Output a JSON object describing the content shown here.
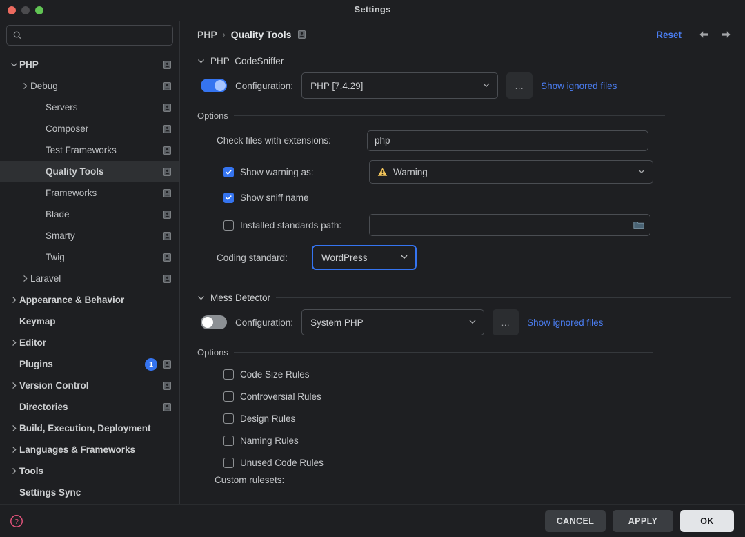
{
  "window": {
    "title": "Settings",
    "traffic_lights": [
      "close",
      "minimize",
      "zoom"
    ]
  },
  "sidebar": {
    "search": {
      "value": "",
      "placeholder": ""
    },
    "items": [
      {
        "label": "PHP",
        "indent": 0,
        "arrow": "down",
        "bold": true,
        "selected": false,
        "project_icon": true,
        "badge": null
      },
      {
        "label": "Debug",
        "indent": 1,
        "arrow": "right",
        "bold": false,
        "selected": false,
        "project_icon": true,
        "badge": null
      },
      {
        "label": "Servers",
        "indent": 2,
        "arrow": "none",
        "bold": false,
        "selected": false,
        "project_icon": true,
        "badge": null
      },
      {
        "label": "Composer",
        "indent": 2,
        "arrow": "none",
        "bold": false,
        "selected": false,
        "project_icon": true,
        "badge": null
      },
      {
        "label": "Test Frameworks",
        "indent": 2,
        "arrow": "none",
        "bold": false,
        "selected": false,
        "project_icon": true,
        "badge": null
      },
      {
        "label": "Quality Tools",
        "indent": 2,
        "arrow": "none",
        "bold": true,
        "selected": true,
        "project_icon": true,
        "badge": null
      },
      {
        "label": "Frameworks",
        "indent": 2,
        "arrow": "none",
        "bold": false,
        "selected": false,
        "project_icon": true,
        "badge": null
      },
      {
        "label": "Blade",
        "indent": 2,
        "arrow": "none",
        "bold": false,
        "selected": false,
        "project_icon": true,
        "badge": null
      },
      {
        "label": "Smarty",
        "indent": 2,
        "arrow": "none",
        "bold": false,
        "selected": false,
        "project_icon": true,
        "badge": null
      },
      {
        "label": "Twig",
        "indent": 2,
        "arrow": "none",
        "bold": false,
        "selected": false,
        "project_icon": true,
        "badge": null
      },
      {
        "label": "Laravel",
        "indent": 1,
        "arrow": "right",
        "bold": false,
        "selected": false,
        "project_icon": true,
        "badge": null
      },
      {
        "label": "Appearance & Behavior",
        "indent": 0,
        "arrow": "right",
        "bold": true,
        "selected": false,
        "project_icon": false,
        "badge": null
      },
      {
        "label": "Keymap",
        "indent": 0,
        "arrow": "none",
        "bold": true,
        "selected": false,
        "project_icon": false,
        "badge": null
      },
      {
        "label": "Editor",
        "indent": 0,
        "arrow": "right",
        "bold": true,
        "selected": false,
        "project_icon": false,
        "badge": null
      },
      {
        "label": "Plugins",
        "indent": 0,
        "arrow": "none",
        "bold": true,
        "selected": false,
        "project_icon": true,
        "badge": "1"
      },
      {
        "label": "Version Control",
        "indent": 0,
        "arrow": "right",
        "bold": true,
        "selected": false,
        "project_icon": true,
        "badge": null
      },
      {
        "label": "Directories",
        "indent": 0,
        "arrow": "none",
        "bold": true,
        "selected": false,
        "project_icon": true,
        "badge": null
      },
      {
        "label": "Build, Execution, Deployment",
        "indent": 0,
        "arrow": "right",
        "bold": true,
        "selected": false,
        "project_icon": false,
        "badge": null
      },
      {
        "label": "Languages & Frameworks",
        "indent": 0,
        "arrow": "right",
        "bold": true,
        "selected": false,
        "project_icon": false,
        "badge": null
      },
      {
        "label": "Tools",
        "indent": 0,
        "arrow": "right",
        "bold": true,
        "selected": false,
        "project_icon": false,
        "badge": null
      },
      {
        "label": "Settings Sync",
        "indent": 0,
        "arrow": "none",
        "bold": true,
        "selected": false,
        "project_icon": false,
        "badge": null
      }
    ]
  },
  "header": {
    "breadcrumb_root": "PHP",
    "breadcrumb_sep": "›",
    "breadcrumb_current": "Quality Tools",
    "reset_label": "Reset",
    "back_icon": "arrow-left-icon",
    "forward_icon": "arrow-right-icon"
  },
  "codesniffer": {
    "section_title": "PHP_CodeSniffer",
    "enabled": true,
    "configuration_label": "Configuration:",
    "configuration_value": "PHP [7.4.29]",
    "browse_label": "…",
    "show_ignored_label": "Show ignored files",
    "options_title": "Options",
    "extensions_label": "Check files with extensions:",
    "extensions_value": "php",
    "show_warning_label": "Show warning as:",
    "show_warning_checked": true,
    "warning_severity": "Warning",
    "warning_icon": "warning-triangle-icon",
    "show_sniff_label": "Show sniff name",
    "show_sniff_checked": true,
    "installed_path_label": "Installed standards path:",
    "installed_path_checked": false,
    "installed_path_value": "",
    "folder_icon": "folder-icon",
    "coding_standard_label": "Coding standard:",
    "coding_standard_value": "WordPress"
  },
  "messdetector": {
    "section_title": "Mess Detector",
    "enabled": false,
    "configuration_label": "Configuration:",
    "configuration_value": "System PHP",
    "browse_label": "…",
    "show_ignored_label": "Show ignored files",
    "options_title": "Options",
    "rules": [
      {
        "label": "Code Size Rules",
        "checked": false
      },
      {
        "label": "Controversial Rules",
        "checked": false
      },
      {
        "label": "Design Rules",
        "checked": false
      },
      {
        "label": "Naming Rules",
        "checked": false
      },
      {
        "label": "Unused Code Rules",
        "checked": false
      }
    ],
    "custom_rulesets_label": "Custom rulesets:"
  },
  "footer": {
    "help_icon": "help-circle-icon",
    "cancel_label": "CANCEL",
    "apply_label": "APPLY",
    "ok_label": "OK"
  },
  "colors": {
    "accent_blue": "#3574f0",
    "link_blue": "#4b7ef3",
    "warning_amber": "#f2c55c",
    "help_pink": "#e0527a",
    "selected_row": "#2e3033"
  }
}
